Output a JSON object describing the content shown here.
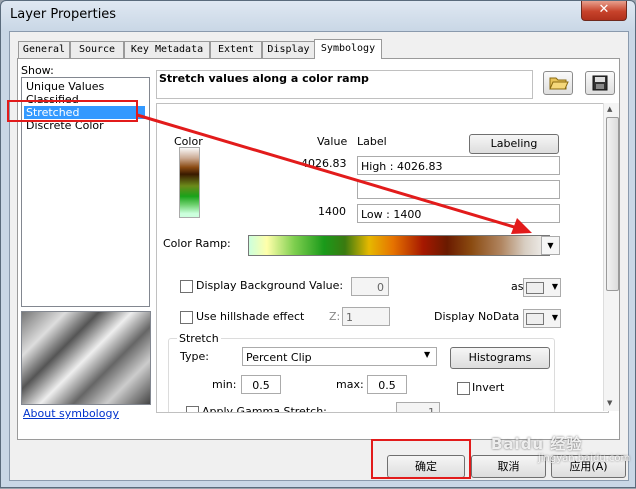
{
  "window": {
    "title": "Layer Properties",
    "close_label": "✕"
  },
  "tabs": [
    {
      "label": "General"
    },
    {
      "label": "Source"
    },
    {
      "label": "Key Metadata"
    },
    {
      "label": "Extent"
    },
    {
      "label": "Display"
    },
    {
      "label": "Symbology",
      "active": true
    }
  ],
  "show": {
    "label": "Show:",
    "items": [
      {
        "label": "Unique Values"
      },
      {
        "label": "Classified"
      },
      {
        "label": "Stretched",
        "selected": true
      },
      {
        "label": "Discrete Color"
      }
    ],
    "about_link": "About symbology"
  },
  "header": {
    "title": "Stretch values along a color ramp",
    "open_icon": "folder-open-icon",
    "save_icon": "floppy-disk-icon"
  },
  "table": {
    "color_header": "Color",
    "value_header": "Value",
    "label_header": "Label",
    "labeling_button": "Labeling",
    "high_value": "4026.83",
    "high_label": "High : 4026.83",
    "mid_label": "",
    "low_value": "1400",
    "low_label": "Low : 1400"
  },
  "color_ramp": {
    "label": "Color Ramp:"
  },
  "background": {
    "label": "Display Background Value:",
    "value": "0",
    "as_label": "as",
    "checked": false
  },
  "hillshade": {
    "label": "Use hillshade effect",
    "z_label": "Z:",
    "z_value": "1",
    "nodata_label": "Display NoData as",
    "checked": false
  },
  "stretch": {
    "group_label": "Stretch",
    "type_label": "Type:",
    "type_value": "Percent Clip",
    "histograms_button": "Histograms",
    "min_label": "min:",
    "min_value": "0.5",
    "max_label": "max:",
    "max_value": "0.5",
    "invert_label": "Invert",
    "invert_checked": false,
    "gamma_label": "Apply Gamma Stretch:",
    "gamma_value": "1",
    "gamma_checked": false
  },
  "buttons": {
    "ok": "确定",
    "cancel": "取消",
    "apply": "应用(A)"
  },
  "watermark": {
    "main": "Baidu 经验",
    "sub": "jingyan.baidu.com"
  },
  "colors": {
    "selection": "#3399ff",
    "highlight": "#e21b1b",
    "link": "#0033cc"
  }
}
